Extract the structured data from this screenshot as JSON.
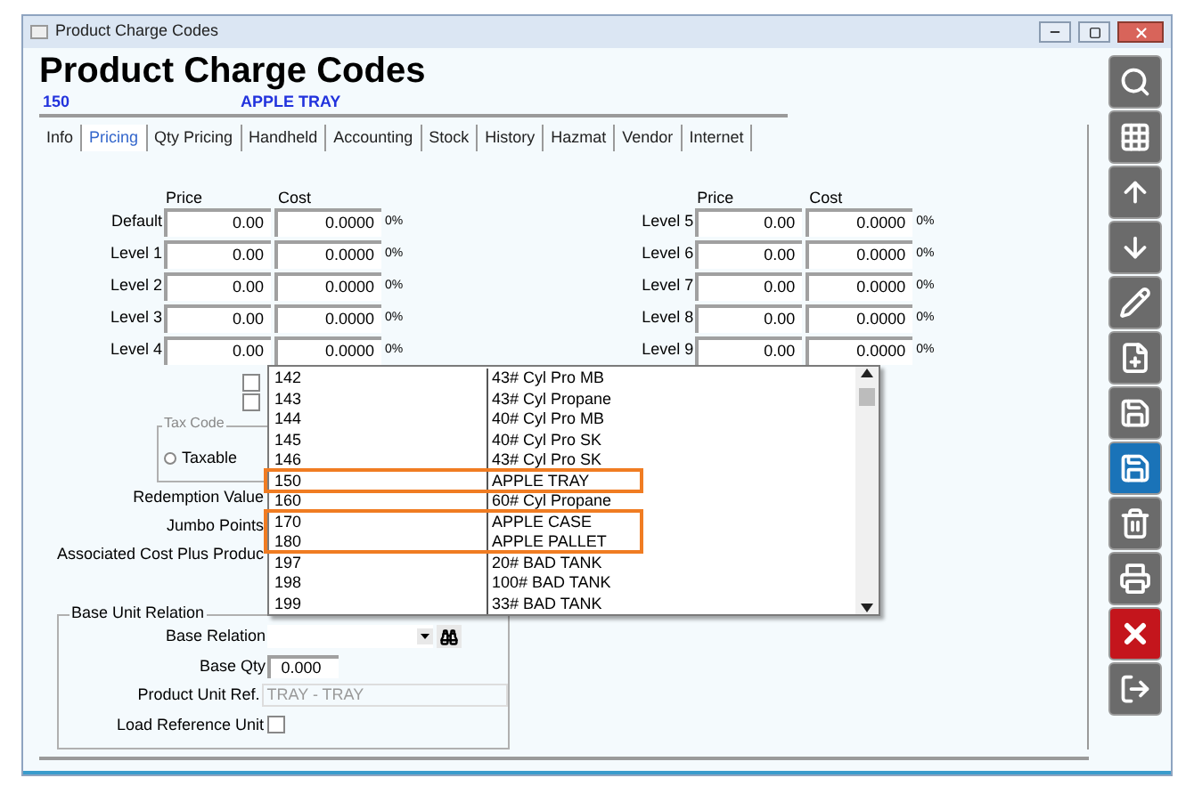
{
  "window": {
    "title": "Product Charge Codes"
  },
  "heading": "Product Charge Codes",
  "record": {
    "code": "150",
    "name": "APPLE TRAY"
  },
  "tabs": [
    {
      "label": "Info",
      "selected": false
    },
    {
      "label": "Pricing",
      "selected": true
    },
    {
      "label": "Qty Pricing",
      "selected": false
    },
    {
      "label": "Handheld",
      "selected": false
    },
    {
      "label": "Accounting",
      "selected": false
    },
    {
      "label": "Stock",
      "selected": false
    },
    {
      "label": "History",
      "selected": false
    },
    {
      "label": "Hazmat",
      "selected": false
    },
    {
      "label": "Vendor",
      "selected": false
    },
    {
      "label": "Internet",
      "selected": false
    }
  ],
  "pricing": [
    {
      "headers": [
        "Price",
        "Cost"
      ],
      "rows": [
        {
          "label": "Default",
          "price": "0.00",
          "cost": "0.0000",
          "percent": "0%"
        },
        {
          "label": "Level 1",
          "price": "0.00",
          "cost": "0.0000",
          "percent": "0%"
        },
        {
          "label": "Level 2",
          "price": "0.00",
          "cost": "0.0000",
          "percent": "0%"
        },
        {
          "label": "Level 3",
          "price": "0.00",
          "cost": "0.0000",
          "percent": "0%"
        },
        {
          "label": "Level 4",
          "price": "0.00",
          "cost": "0.0000",
          "percent": "0%"
        }
      ]
    },
    {
      "headers": [
        "Price",
        "Cost"
      ],
      "rows": [
        {
          "label": "Level 5",
          "price": "0.00",
          "cost": "0.0000",
          "percent": "0%"
        },
        {
          "label": "Level 6",
          "price": "0.00",
          "cost": "0.0000",
          "percent": "0%"
        },
        {
          "label": "Level 7",
          "price": "0.00",
          "cost": "0.0000",
          "percent": "0%"
        },
        {
          "label": "Level 8",
          "price": "0.00",
          "cost": "0.0000",
          "percent": "0%"
        },
        {
          "label": "Level 9",
          "price": "0.00",
          "cost": "0.0000",
          "percent": "0%"
        }
      ]
    }
  ],
  "flags": [
    {
      "checked": false
    },
    {
      "checked": false
    }
  ],
  "tax_code": {
    "title": "Tax Code",
    "options": [
      {
        "label": "Taxable",
        "selected": false
      }
    ]
  },
  "field_labels": [
    "Redemption Value",
    "Jumbo Points",
    "Associated Cost Plus Produc"
  ],
  "base_unit_relation": {
    "title": "Base Unit Relation",
    "base_relation": {
      "label": "Base Relation"
    },
    "base_qty": {
      "label": "Base Qty",
      "value": "0.000"
    },
    "product_unit_ref": {
      "label": "Product Unit Ref.",
      "value": "TRAY - TRAY",
      "disabled": true
    },
    "load_reference_unit": {
      "label": "Load Reference Unit",
      "checked": false
    }
  },
  "dropdown": {
    "rows": [
      {
        "code": "142",
        "name": "43# Cyl Pro MB",
        "highlighted": false
      },
      {
        "code": "143",
        "name": "43# Cyl Propane",
        "highlighted": false
      },
      {
        "code": "144",
        "name": "40# Cyl Pro MB",
        "highlighted": false
      },
      {
        "code": "145",
        "name": "40# Cyl Pro SK",
        "highlighted": false
      },
      {
        "code": "146",
        "name": "43# Cyl Pro SK",
        "highlighted": false
      },
      {
        "code": "150",
        "name": "APPLE TRAY",
        "highlighted": true
      },
      {
        "code": "160",
        "name": "60# Cyl Propane",
        "highlighted": false
      },
      {
        "code": "170",
        "name": "APPLE CASE",
        "highlighted": true
      },
      {
        "code": "180",
        "name": "APPLE PALLET",
        "highlighted": true
      },
      {
        "code": "197",
        "name": "20# BAD TANK",
        "highlighted": false
      },
      {
        "code": "198",
        "name": "100# BAD TANK",
        "highlighted": false
      },
      {
        "code": "199",
        "name": "33# BAD TANK",
        "highlighted": false
      }
    ]
  },
  "toolbar": [
    {
      "kind": "search",
      "color": "#6b6b6b"
    },
    {
      "kind": "grid",
      "color": "#6b6b6b"
    },
    {
      "kind": "up",
      "color": "#6b6b6b"
    },
    {
      "kind": "down",
      "color": "#6b6b6b"
    },
    {
      "kind": "edit",
      "color": "#6b6b6b"
    },
    {
      "kind": "new",
      "color": "#6b6b6b"
    },
    {
      "kind": "save-new",
      "color": "#6b6b6b"
    },
    {
      "kind": "save",
      "color": "#1a73b8"
    },
    {
      "kind": "delete",
      "color": "#6b6b6b"
    },
    {
      "kind": "print",
      "color": "#6b6b6b"
    },
    {
      "kind": "cancel",
      "color": "#c4151c"
    },
    {
      "kind": "exit",
      "color": "#6b6b6b"
    }
  ]
}
